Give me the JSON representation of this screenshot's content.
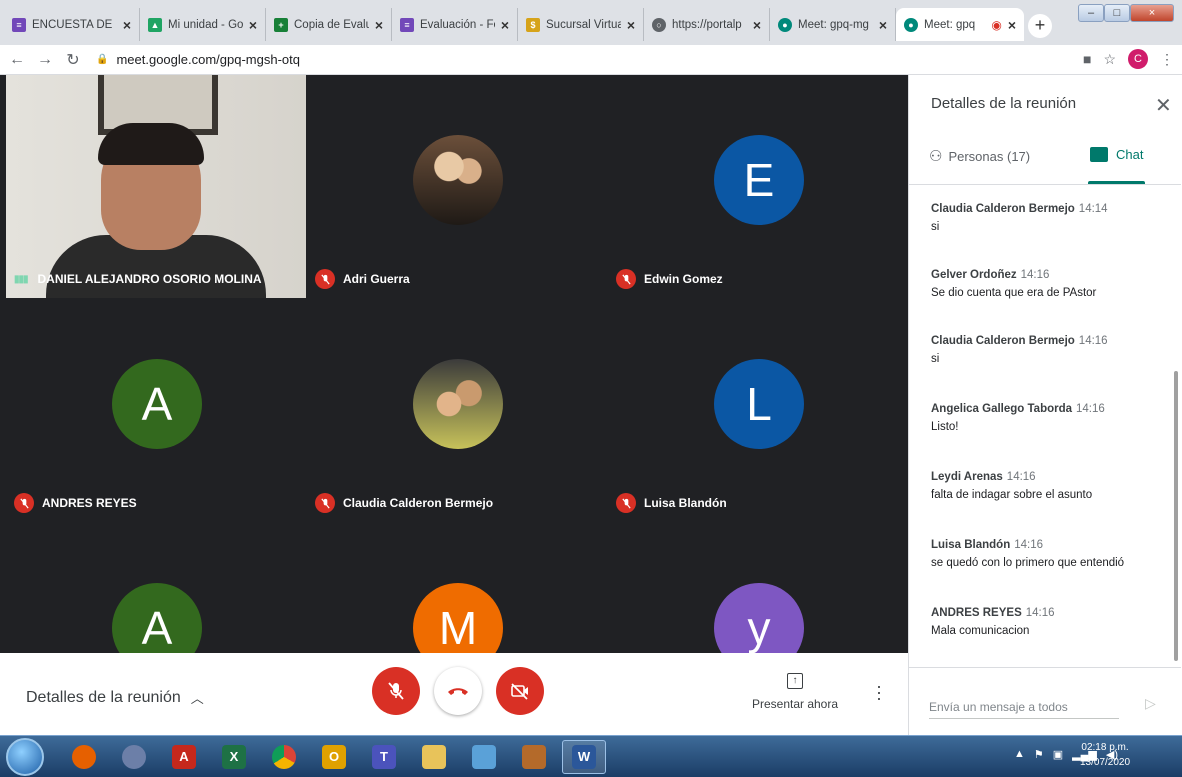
{
  "browser": {
    "tabs": [
      {
        "label": "ENCUESTA DE",
        "icon": "forms-icon",
        "color": "#7248b9"
      },
      {
        "label": "Mi unidad - Go",
        "icon": "drive-icon",
        "color": "#1fa463"
      },
      {
        "label": "Copia de Evalu",
        "icon": "sheets-icon",
        "color": "#188038"
      },
      {
        "label": "Evaluación - Fo",
        "icon": "forms-icon",
        "color": "#7248b9"
      },
      {
        "label": "Sucursal Virtua",
        "icon": "bank-icon",
        "color": "#d6a31a"
      },
      {
        "label": "https://portalp",
        "icon": "globe-icon",
        "color": "#5f6368"
      },
      {
        "label": "Meet: gpq-mg",
        "icon": "meet-icon",
        "color": "#00897b"
      },
      {
        "label": "Meet: gpq",
        "icon": "meet-icon",
        "color": "#00897b"
      }
    ],
    "url": "meet.google.com/gpq-mgsh-otq",
    "profile_initial": "C"
  },
  "tiles": [
    {
      "name": "DANIEL ALEJANDRO OSORIO MOLINA",
      "type": "camera"
    },
    {
      "name": "Adri Guerra",
      "type": "photo"
    },
    {
      "name": "Edwin Gomez",
      "type": "letter",
      "letter": "E",
      "color": "#0b57a4"
    },
    {
      "name": "ANDRES REYES",
      "type": "letter",
      "letter": "A",
      "color": "#33691e"
    },
    {
      "name": "Claudia Calderon Bermejo",
      "type": "photo"
    },
    {
      "name": "Luisa Blandón",
      "type": "letter",
      "letter": "L",
      "color": "#0b57a4"
    },
    {
      "name": "",
      "type": "letter",
      "letter": "A",
      "color": "#33691e"
    },
    {
      "name": "",
      "type": "letter",
      "letter": "M",
      "color": "#ef6c00"
    },
    {
      "name": "",
      "type": "letter",
      "letter": "y",
      "color": "#7e57c2"
    }
  ],
  "bottom": {
    "details_label": "Detalles de la reunión",
    "present_label": "Presentar ahora"
  },
  "panel": {
    "title": "Detalles de la reunión",
    "people_tab": "Personas (17)",
    "chat_tab": "Chat",
    "messages": [
      {
        "sender": "Claudia Calderon Bermejo",
        "time": "14:14",
        "text": "si"
      },
      {
        "sender": "Gelver Ordoñez",
        "time": "14:16",
        "text": "Se dio cuenta que era de PAstor"
      },
      {
        "sender": "Claudia Calderon Bermejo",
        "time": "14:16",
        "text": "si"
      },
      {
        "sender": "Angelica Gallego Taborda",
        "time": "14:16",
        "text": "Listo!"
      },
      {
        "sender": "Leydi Arenas",
        "time": "14:16",
        "text": "falta de indagar sobre el asunto"
      },
      {
        "sender": "Luisa Blandón",
        "time": "14:16",
        "text": "se quedó con lo primero que entendió"
      },
      {
        "sender": "ANDRES REYES",
        "time": "14:16",
        "text": "Mala comunicacion"
      }
    ],
    "compose_placeholder": "Envía un mensaje a todos"
  },
  "taskbar": {
    "apps": [
      {
        "icon": "firefox-icon",
        "color": "#e66000"
      },
      {
        "icon": "user-search-icon",
        "color": "#6c7fa8"
      },
      {
        "icon": "acrobat-icon",
        "color": "#c5281c",
        "glyph": "A"
      },
      {
        "icon": "excel-icon",
        "color": "#1e7145",
        "glyph": "X"
      },
      {
        "icon": "chrome-icon",
        "color": "#e8a317"
      },
      {
        "icon": "outlook-icon",
        "color": "#e0a100",
        "glyph": "O"
      },
      {
        "icon": "teams-icon",
        "color": "#4b53bc",
        "glyph": "T"
      },
      {
        "icon": "folder-icon",
        "color": "#e8c35a"
      },
      {
        "icon": "ink-icon",
        "color": "#5aa1d8"
      },
      {
        "icon": "paint-icon",
        "color": "#b46a2a"
      },
      {
        "icon": "word-icon",
        "color": "#2b579a",
        "glyph": "W"
      }
    ],
    "time": "02:18 p.m.",
    "date": "13/07/2020"
  }
}
